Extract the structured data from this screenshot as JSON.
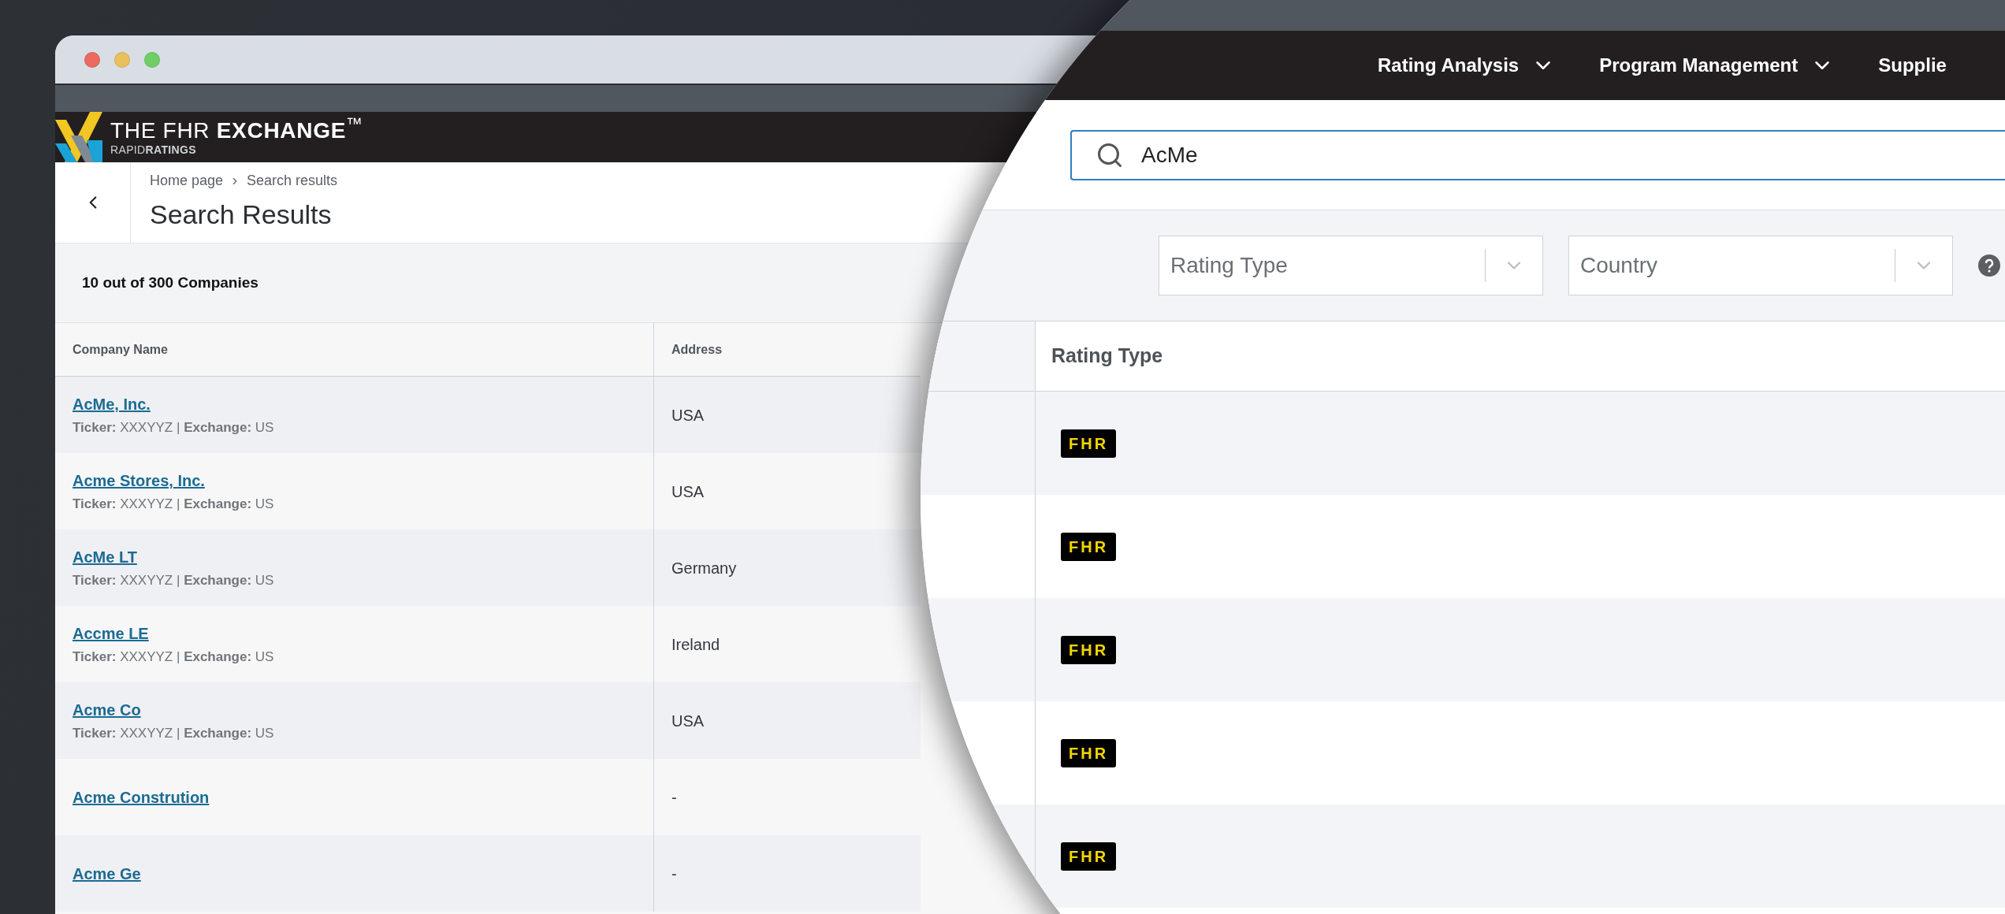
{
  "browser": {
    "window_controls": [
      {
        "color": "#ec6a5f"
      },
      {
        "color": "#e8c05c"
      },
      {
        "color": "#6fcf66"
      }
    ],
    "logo": {
      "title": "THE FHR **EXCHANGE**$^{™}$",
      "subtitle": "RAPID**RATINGS**"
    },
    "breadcrumb": [
      "Home page",
      "Search results"
    ],
    "title": "Search Results",
    "count": "10 out of 300 Companies",
    "table": {
      "columns": [
        "Company Name",
        "Address"
      ],
      "rows": [
        {
          "name": "AcMe, Inc.",
          "details": "**Ticker:** XXXYYZ | **Exchange:** US",
          "address": "USA"
        },
        {
          "name": "Acme Stores, Inc.",
          "details": "**Ticker:** XXXYYZ | **Exchange:** US",
          "address": "USA"
        },
        {
          "name": "AcMe LT",
          "details": "**Ticker:** XXXYYZ | **Exchange:** US",
          "address": "Germany"
        },
        {
          "name": "Accme LE",
          "details": "**Ticker:** XXXYYZ | **Exchange:** US",
          "address": "Ireland"
        },
        {
          "name": "Acme Co",
          "details": "**Ticker:** XXXYYZ | **Exchange:** US",
          "address": "USA"
        },
        {
          "name": "Acme Constrution",
          "address": "-"
        },
        {
          "name": "Acme Ge",
          "address": "-"
        }
      ]
    }
  },
  "magnified": {
    "nav_items": [
      {
        "label": "Rating Analysis",
        "has_menu": true
      },
      {
        "label": "Program Management",
        "has_menu": true
      },
      {
        "label": "Supplie",
        "has_menu": false
      }
    ],
    "search": {
      "value": "AcMe"
    },
    "filters": [
      {
        "placeholder": "Rating Type"
      },
      {
        "placeholder": "Country"
      }
    ],
    "table": {
      "columns": [
        "Rating Type"
      ],
      "rows": [
        {
          "rating_type": "FHR"
        },
        {
          "rating_type": "FHR"
        },
        {
          "rating_type": "FHR"
        },
        {
          "rating_type": "FHR"
        },
        {
          "rating_type": "FHR"
        }
      ]
    }
  }
}
